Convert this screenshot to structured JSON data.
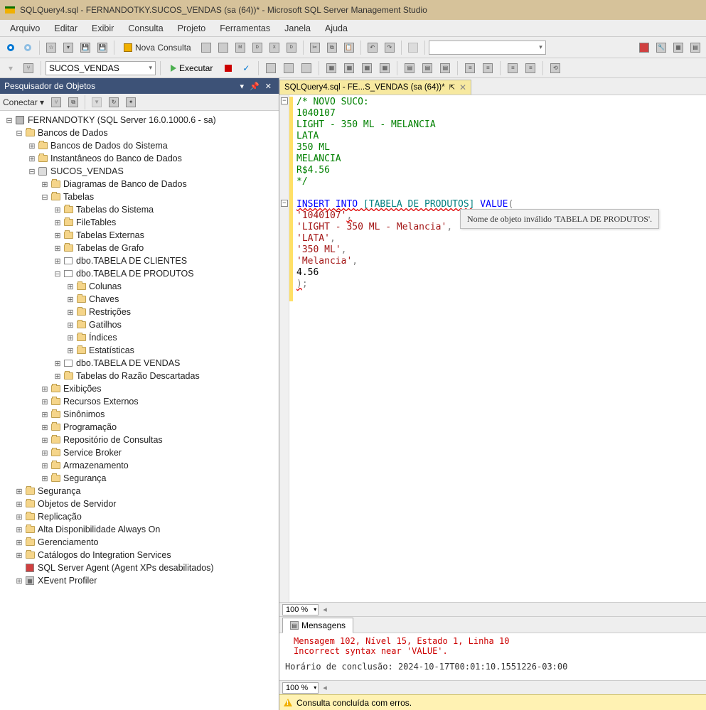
{
  "title": "SQLQuery4.sql - FERNANDOTKY.SUCOS_VENDAS (sa (64))* - Microsoft SQL Server Management Studio",
  "menu": [
    "Arquivo",
    "Editar",
    "Exibir",
    "Consulta",
    "Projeto",
    "Ferramentas",
    "Janela",
    "Ajuda"
  ],
  "toolbar": {
    "nova_consulta": "Nova Consulta",
    "db_combo": "SUCOS_VENDAS",
    "executar": "Executar"
  },
  "object_explorer": {
    "title": "Pesquisador de Objetos",
    "conectar": "Conectar",
    "tree": {
      "server": "FERNANDOTKY (SQL Server 16.0.1000.6 - sa)",
      "databases": "Bancos de Dados",
      "system_db": "Bancos de Dados do Sistema",
      "snapshots": "Instantâneos do Banco de Dados",
      "sucos": "SUCOS_VENDAS",
      "diagrams": "Diagramas de Banco de Dados",
      "tables": "Tabelas",
      "system_tables": "Tabelas do Sistema",
      "filetables": "FileTables",
      "external_tables": "Tabelas Externas",
      "graph_tables": "Tabelas de Grafo",
      "clientes": "dbo.TABELA DE CLIENTES",
      "produtos": "dbo.TABELA DE PRODUTOS",
      "colunas": "Colunas",
      "chaves": "Chaves",
      "restricoes": "Restrições",
      "gatilhos": "Gatilhos",
      "indices": "Índices",
      "estatisticas": "Estatísticas",
      "vendas": "dbo.TABELA DE VENDAS",
      "razao": "Tabelas do Razão Descartadas",
      "exibicoes": "Exibições",
      "recursos": "Recursos Externos",
      "sinonimos": "Sinônimos",
      "programacao": "Programação",
      "repo": "Repositório de Consultas",
      "broker": "Service Broker",
      "armazenamento": "Armazenamento",
      "seguranca_db": "Segurança",
      "seguranca": "Segurança",
      "obj_servidor": "Objetos de Servidor",
      "replicacao": "Replicação",
      "alta": "Alta Disponibilidade Always On",
      "gerenciamento": "Gerenciamento",
      "catalogos": "Catálogos do Integration Services",
      "agent": "SQL Server Agent (Agent XPs desabilitados)",
      "xevent": "XEvent Profiler"
    }
  },
  "tab": {
    "label": "SQLQuery4.sql - FE...S_VENDAS (sa (64))*"
  },
  "code": {
    "l1": "/* NOVO SUCO:",
    "l2": "1040107",
    "l3": "LIGHT - 350 ML - MELANCIA",
    "l4": "LATA",
    "l5": "350 ML",
    "l6": "MELANCIA",
    "l7": "R$4.56",
    "l8": "*/",
    "l10a": "INSERT",
    "l10b": " INTO",
    "l10c": " [TABELA DE PRODUTOS]",
    "l10d": " VALUE",
    "l10e": "(",
    "l11": "'1040107'",
    "l12": "'LIGHT - 350 ML - Melancia'",
    "l13": "'LATA'",
    "l14": "'350 ML'",
    "l15": "'Melancia'",
    "l16": "4.56",
    "l17a": ")",
    "l17b": ";",
    "comma": ","
  },
  "tooltip": "Nome de objeto inválido 'TABELA DE PRODUTOS'.",
  "zoom": "100 %",
  "messages": {
    "tab": "Mensagens",
    "line1": "Mensagem 102, Nível 15, Estado 1, Linha 10",
    "line2": "Incorrect syntax near 'VALUE'.",
    "line3": "Horário de conclusão: 2024-10-17T00:01:10.1551226-03:00"
  },
  "status": "Consulta concluída com erros."
}
